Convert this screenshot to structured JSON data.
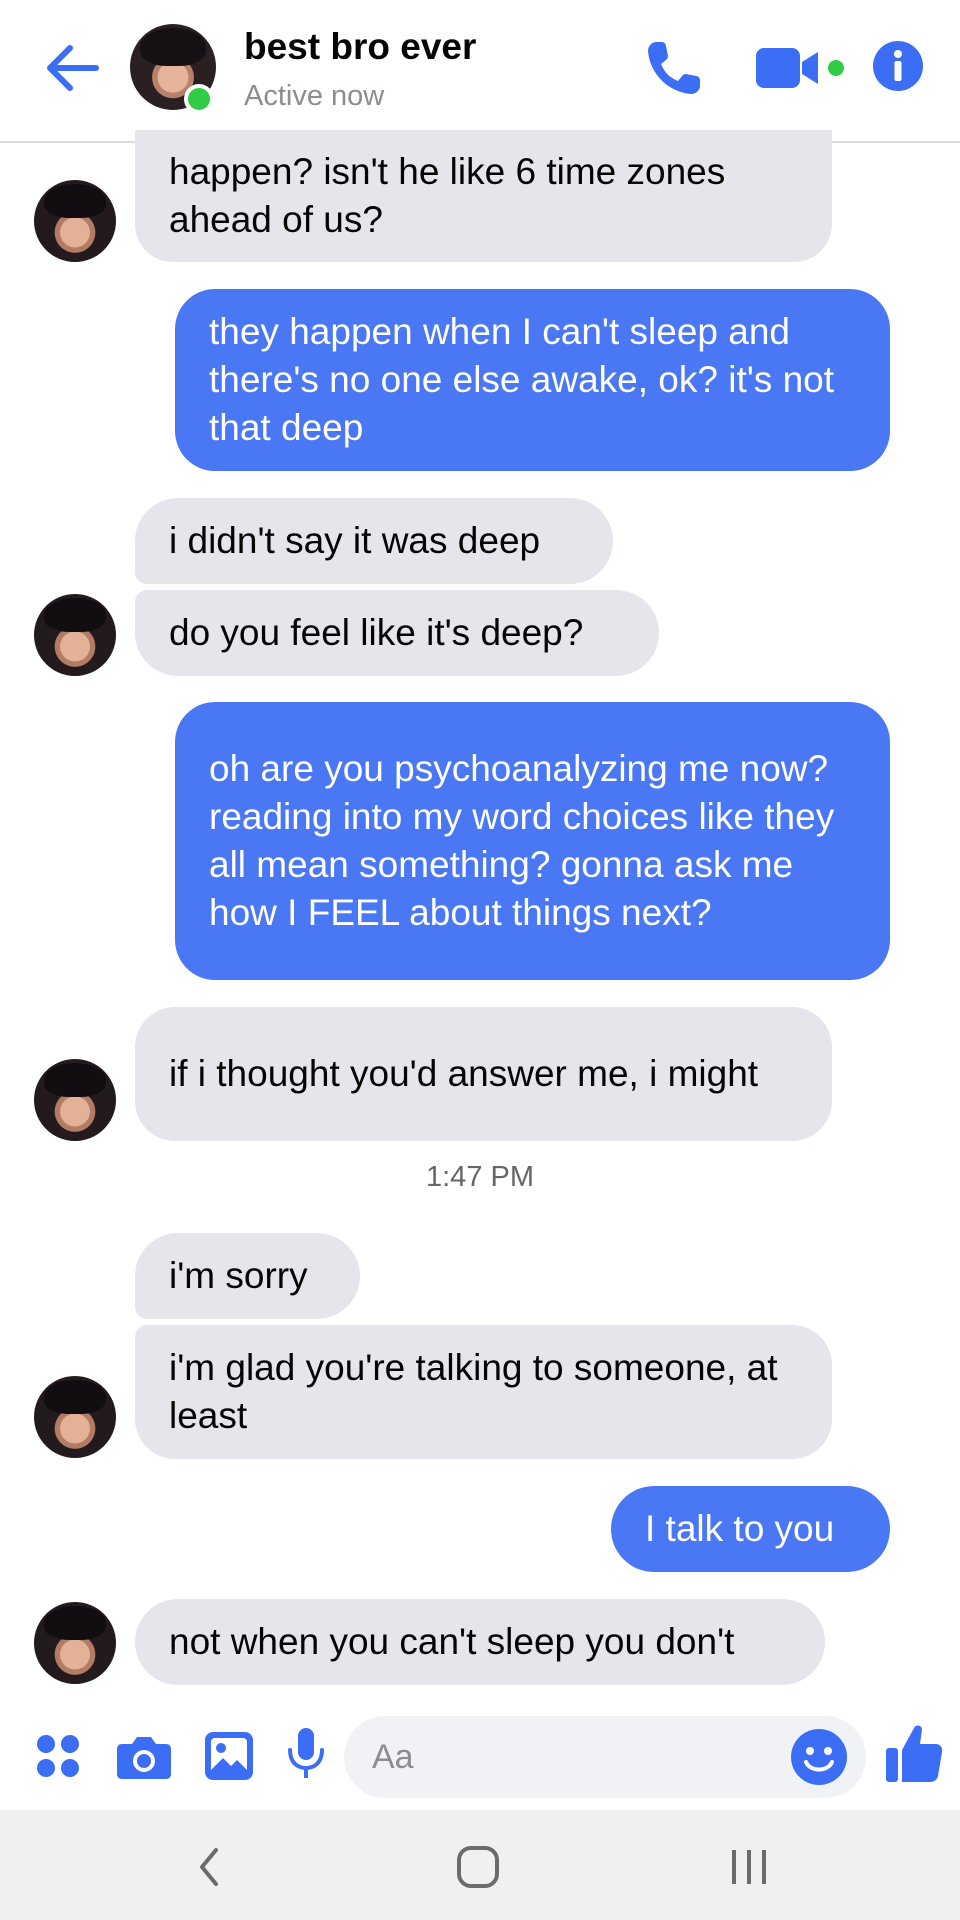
{
  "header": {
    "contact_name": "best bro ever",
    "status": "Active now",
    "back_icon": "arrow-left-icon",
    "phone_icon": "phone-icon",
    "video_icon": "video-camera-icon",
    "info_icon": "info-icon",
    "accent_color": "#3b6ef5",
    "online_color": "#31cc46"
  },
  "messages": [
    {
      "sender": "contact",
      "text": "happen? isn't he like 6 time zones ahead of us?"
    },
    {
      "sender": "me",
      "text": "they happen when I can't sleep and there's no one else awake, ok? it's not that deep"
    },
    {
      "sender": "contact",
      "text": "i didn't say it was deep"
    },
    {
      "sender": "contact",
      "text": "do you feel like it's deep?"
    },
    {
      "sender": "me",
      "text": "oh are you psychoanalyzing me now? reading into my word choices like they all mean something? gonna ask me how I FEEL about things next?"
    },
    {
      "sender": "contact",
      "text": "if i thought you'd answer me, i might"
    },
    {
      "sender": "contact",
      "text": "i'm sorry"
    },
    {
      "sender": "contact",
      "text": "i'm glad you're talking to someone, at least"
    },
    {
      "sender": "me",
      "text": "I talk to you"
    },
    {
      "sender": "contact",
      "text": "not when you can't sleep you don't"
    }
  ],
  "timestamp": "1:47 PM",
  "composer": {
    "placeholder": "Aa",
    "icons": [
      "apps-grid-icon",
      "camera-icon",
      "image-icon",
      "microphone-icon",
      "emoji-icon",
      "thumbs-up-icon"
    ]
  },
  "system_nav": {
    "icons": [
      "back-chevron-icon",
      "home-icon",
      "recent-apps-icon"
    ]
  },
  "colors": {
    "incoming_bubble": "#e4e6eb",
    "outgoing_bubble": "#4a77f4"
  }
}
